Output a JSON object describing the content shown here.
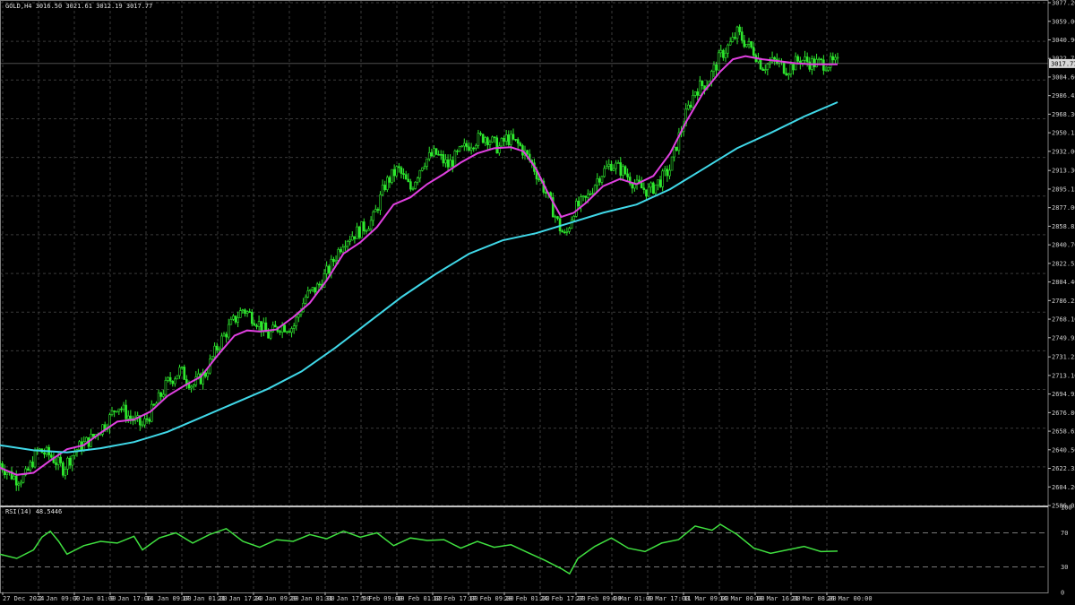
{
  "chart_data": {
    "type": "candlestick",
    "header": "GOLD,H4  3016.50 3021.61 3012.19 3017.77",
    "current_price": "3017.77",
    "price_axis": {
      "ticks": [
        "3077.20",
        "3059.00",
        "3040.90",
        "3022.75",
        "3004.60",
        "2986.45",
        "2968.30",
        "2950.15",
        "2932.00",
        "2913.30",
        "2895.15",
        "2877.00",
        "2858.85",
        "2840.70",
        "2822.55",
        "2804.40",
        "2786.25",
        "2768.10",
        "2749.95",
        "2731.25",
        "2713.10",
        "2694.95",
        "2676.80",
        "2658.65",
        "2640.50",
        "2622.35",
        "2604.20",
        "2586.05"
      ],
      "range": [
        2586.05,
        3077.2
      ]
    },
    "time_axis": {
      "labels": [
        "27 Dec 2024",
        "2 Jan 09:00",
        "7 Jan 01:00",
        "9 Jan 17:00",
        "14 Jan 09:00",
        "17 Jan 01:00",
        "21 Jan 17:00",
        "24 Jan 09:00",
        "29 Jan 01:00",
        "31 Jan 17:00",
        "5 Feb 09:00",
        "10 Feb 01:00",
        "12 Feb 17:00",
        "17 Feb 09:00",
        "20 Feb 01:00",
        "24 Feb 17:00",
        "27 Feb 09:00",
        "4 Mar 01:00",
        "6 Mar 17:00",
        "11 Mar 09:00",
        "14 Mar 00:00",
        "18 Mar 16:00",
        "21 Mar 08:00",
        "26 Mar 00:00"
      ]
    },
    "price_path": [
      [
        0,
        2627
      ],
      [
        0.01,
        2618
      ],
      [
        0.02,
        2612
      ],
      [
        0.03,
        2614
      ],
      [
        0.045,
        2640
      ],
      [
        0.06,
        2635
      ],
      [
        0.075,
        2622
      ],
      [
        0.09,
        2640
      ],
      [
        0.11,
        2652
      ],
      [
        0.13,
        2670
      ],
      [
        0.14,
        2685
      ],
      [
        0.155,
        2672
      ],
      [
        0.17,
        2664
      ],
      [
        0.185,
        2683
      ],
      [
        0.2,
        2706
      ],
      [
        0.215,
        2718
      ],
      [
        0.23,
        2703
      ],
      [
        0.245,
        2715
      ],
      [
        0.26,
        2742
      ],
      [
        0.275,
        2762
      ],
      [
        0.29,
        2778
      ],
      [
        0.305,
        2768
      ],
      [
        0.32,
        2752
      ],
      [
        0.335,
        2762
      ],
      [
        0.35,
        2760
      ],
      [
        0.365,
        2790
      ],
      [
        0.38,
        2800
      ],
      [
        0.395,
        2820
      ],
      [
        0.41,
        2845
      ],
      [
        0.43,
        2855
      ],
      [
        0.445,
        2865
      ],
      [
        0.46,
        2900
      ],
      [
        0.475,
        2915
      ],
      [
        0.49,
        2895
      ],
      [
        0.505,
        2922
      ],
      [
        0.52,
        2930
      ],
      [
        0.535,
        2918
      ],
      [
        0.55,
        2932
      ],
      [
        0.565,
        2942
      ],
      [
        0.58,
        2947
      ],
      [
        0.595,
        2935
      ],
      [
        0.605,
        2945
      ],
      [
        0.62,
        2938
      ],
      [
        0.635,
        2920
      ],
      [
        0.65,
        2895
      ],
      [
        0.66,
        2875
      ],
      [
        0.668,
        2858
      ],
      [
        0.675,
        2848
      ],
      [
        0.685,
        2875
      ],
      [
        0.7,
        2885
      ],
      [
        0.715,
        2908
      ],
      [
        0.73,
        2920
      ],
      [
        0.745,
        2912
      ],
      [
        0.76,
        2898
      ],
      [
        0.775,
        2893
      ],
      [
        0.79,
        2905
      ],
      [
        0.8,
        2915
      ],
      [
        0.81,
        2945
      ],
      [
        0.82,
        2970
      ],
      [
        0.83,
        2992
      ],
      [
        0.845,
        3000
      ],
      [
        0.86,
        3025
      ],
      [
        0.875,
        3040
      ],
      [
        0.88,
        3048
      ],
      [
        0.89,
        3038
      ],
      [
        0.9,
        3030
      ],
      [
        0.91,
        3015
      ],
      [
        0.925,
        3020
      ],
      [
        0.94,
        3012
      ],
      [
        0.955,
        3022
      ],
      [
        0.97,
        3018
      ],
      [
        1,
        3017.77
      ]
    ],
    "series": [
      {
        "name": "",
        "color": "#e040e0",
        "path": [
          [
            0,
            2623
          ],
          [
            0.02,
            2616
          ],
          [
            0.04,
            2618
          ],
          [
            0.06,
            2630
          ],
          [
            0.08,
            2641
          ],
          [
            0.1,
            2645
          ],
          [
            0.12,
            2657
          ],
          [
            0.14,
            2668
          ],
          [
            0.16,
            2670
          ],
          [
            0.18,
            2678
          ],
          [
            0.2,
            2693
          ],
          [
            0.22,
            2703
          ],
          [
            0.24,
            2712
          ],
          [
            0.26,
            2733
          ],
          [
            0.28,
            2752
          ],
          [
            0.295,
            2757
          ],
          [
            0.31,
            2756
          ],
          [
            0.33,
            2758
          ],
          [
            0.35,
            2770
          ],
          [
            0.37,
            2784
          ],
          [
            0.39,
            2806
          ],
          [
            0.41,
            2832
          ],
          [
            0.43,
            2843
          ],
          [
            0.45,
            2858
          ],
          [
            0.47,
            2880
          ],
          [
            0.49,
            2887
          ],
          [
            0.51,
            2900
          ],
          [
            0.53,
            2910
          ],
          [
            0.55,
            2921
          ],
          [
            0.57,
            2930
          ],
          [
            0.59,
            2935
          ],
          [
            0.61,
            2936
          ],
          [
            0.625,
            2932
          ],
          [
            0.64,
            2915
          ],
          [
            0.655,
            2890
          ],
          [
            0.67,
            2868
          ],
          [
            0.685,
            2872
          ],
          [
            0.7,
            2882
          ],
          [
            0.72,
            2898
          ],
          [
            0.74,
            2905
          ],
          [
            0.76,
            2900
          ],
          [
            0.78,
            2908
          ],
          [
            0.8,
            2930
          ],
          [
            0.82,
            2962
          ],
          [
            0.84,
            2990
          ],
          [
            0.86,
            3010
          ],
          [
            0.875,
            3022
          ],
          [
            0.89,
            3025
          ],
          [
            0.91,
            3022
          ],
          [
            0.93,
            3020
          ],
          [
            0.95,
            3018
          ],
          [
            0.97,
            3017
          ],
          [
            1,
            3017
          ]
        ]
      },
      {
        "name": "",
        "color": "#40d8e8",
        "path": [
          [
            0,
            2645
          ],
          [
            0.04,
            2640
          ],
          [
            0.08,
            2638
          ],
          [
            0.12,
            2642
          ],
          [
            0.16,
            2648
          ],
          [
            0.2,
            2658
          ],
          [
            0.24,
            2672
          ],
          [
            0.28,
            2686
          ],
          [
            0.32,
            2700
          ],
          [
            0.36,
            2717
          ],
          [
            0.4,
            2740
          ],
          [
            0.44,
            2765
          ],
          [
            0.48,
            2790
          ],
          [
            0.52,
            2812
          ],
          [
            0.56,
            2832
          ],
          [
            0.6,
            2845
          ],
          [
            0.64,
            2852
          ],
          [
            0.68,
            2862
          ],
          [
            0.72,
            2872
          ],
          [
            0.76,
            2880
          ],
          [
            0.8,
            2895
          ],
          [
            0.84,
            2915
          ],
          [
            0.88,
            2935
          ],
          [
            0.92,
            2950
          ],
          [
            0.96,
            2966
          ],
          [
            1,
            2980
          ]
        ]
      }
    ],
    "rsi": {
      "label": "RSI(14) 48.5446",
      "color": "#40e040",
      "levels": [
        70,
        30
      ],
      "axis_ticks": [
        "100",
        "70",
        "30",
        "0"
      ],
      "path": [
        [
          0,
          45
        ],
        [
          0.02,
          40
        ],
        [
          0.04,
          50
        ],
        [
          0.05,
          65
        ],
        [
          0.06,
          72
        ],
        [
          0.07,
          60
        ],
        [
          0.08,
          45
        ],
        [
          0.1,
          55
        ],
        [
          0.12,
          60
        ],
        [
          0.14,
          58
        ],
        [
          0.16,
          66
        ],
        [
          0.17,
          50
        ],
        [
          0.19,
          64
        ],
        [
          0.21,
          70
        ],
        [
          0.23,
          58
        ],
        [
          0.25,
          68
        ],
        [
          0.27,
          75
        ],
        [
          0.29,
          60
        ],
        [
          0.31,
          53
        ],
        [
          0.33,
          62
        ],
        [
          0.35,
          60
        ],
        [
          0.37,
          68
        ],
        [
          0.39,
          63
        ],
        [
          0.41,
          72
        ],
        [
          0.43,
          65
        ],
        [
          0.45,
          70
        ],
        [
          0.47,
          55
        ],
        [
          0.49,
          64
        ],
        [
          0.51,
          61
        ],
        [
          0.53,
          62
        ],
        [
          0.55,
          52
        ],
        [
          0.57,
          60
        ],
        [
          0.59,
          53
        ],
        [
          0.61,
          56
        ],
        [
          0.63,
          47
        ],
        [
          0.65,
          38
        ],
        [
          0.67,
          28
        ],
        [
          0.68,
          22
        ],
        [
          0.69,
          40
        ],
        [
          0.71,
          54
        ],
        [
          0.73,
          64
        ],
        [
          0.75,
          52
        ],
        [
          0.77,
          48
        ],
        [
          0.79,
          58
        ],
        [
          0.81,
          62
        ],
        [
          0.83,
          78
        ],
        [
          0.85,
          73
        ],
        [
          0.86,
          80
        ],
        [
          0.88,
          68
        ],
        [
          0.9,
          52
        ],
        [
          0.92,
          46
        ],
        [
          0.94,
          50
        ],
        [
          0.96,
          54
        ],
        [
          0.98,
          48
        ],
        [
          1,
          48.5446
        ]
      ]
    },
    "grid": true,
    "background": "#000000"
  }
}
